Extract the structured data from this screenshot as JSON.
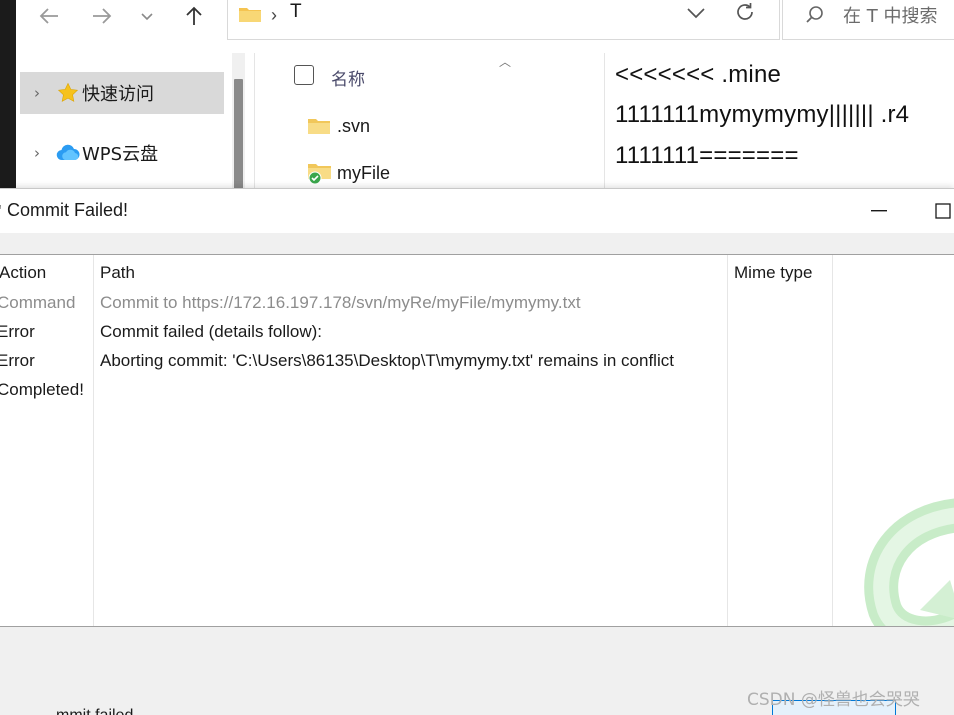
{
  "explorer": {
    "breadcrumb": {
      "separator": "›",
      "current": "T"
    },
    "search_placeholder": "在 T 中搜索",
    "nav": {
      "items": [
        {
          "label": "快速访问",
          "icon": "star-icon",
          "selected": true
        },
        {
          "label": "WPS云盘",
          "icon": "cloud-icon",
          "selected": false
        }
      ]
    },
    "files": {
      "column_name": "名称",
      "rows": [
        {
          "name": ".svn",
          "icon": "folder-icon"
        },
        {
          "name": "myFile",
          "icon": "folder-conflict-icon"
        }
      ]
    },
    "preview": {
      "lines": [
        "<<<<<<< .mine",
        "1111111mymymymy||||||| .r4",
        "1111111======="
      ]
    }
  },
  "dialog": {
    "title": "Commit Failed!",
    "columns": {
      "action": "Action",
      "path": "Path",
      "mime": "Mime type"
    },
    "rows": [
      {
        "action": "Command",
        "path": "Commit to https://172.16.197.178/svn/myRe/myFile/mymymy.txt",
        "muted": true
      },
      {
        "action": "Error",
        "path": "Commit failed (details follow):",
        "muted": false
      },
      {
        "action": "Error",
        "path": "Aborting commit: 'C:\\Users\\86135\\Desktop\\T\\mymymy.txt' remains in conflict",
        "muted": false
      },
      {
        "action": "Completed!",
        "path": "",
        "muted": false
      }
    ],
    "bottom_text": "mmit failed",
    "credit": "CSDN @怪兽也会哭哭"
  },
  "colors": {
    "accent": "#0078d7",
    "folder": "#f5c451",
    "conflict": "#3aa64c",
    "selection": "#d9d9d9"
  }
}
